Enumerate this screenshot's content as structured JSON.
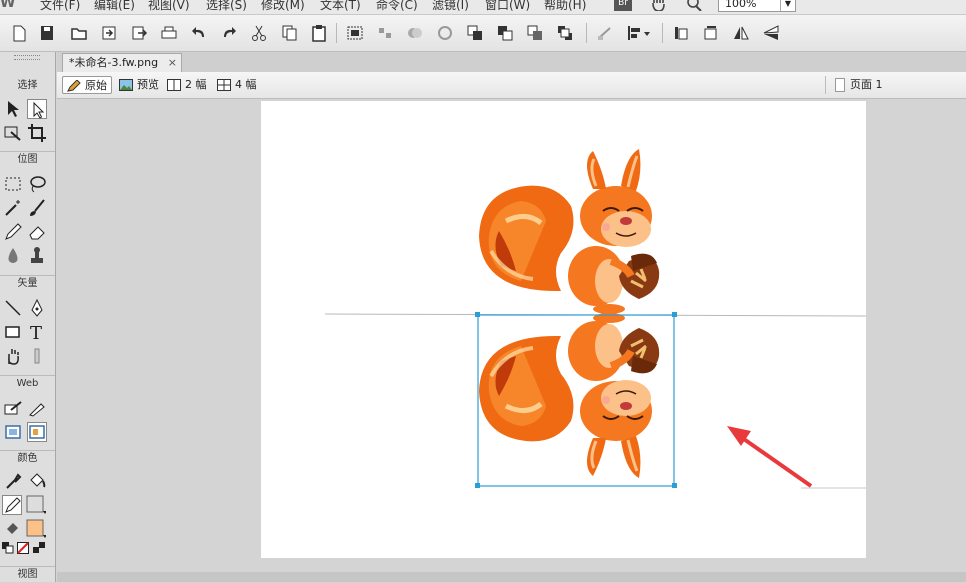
{
  "menu": {
    "logo": "W",
    "items": [
      "文件(F)",
      "编辑(E)",
      "视图(V)",
      "选择(S)",
      "修改(M)",
      "文本(T)",
      "命令(C)",
      "滤镜(I)",
      "窗口(W)",
      "帮助(H)"
    ],
    "bridge_label": "Br",
    "zoom": "100%"
  },
  "tabs": {
    "document": "*未命名-3.fw.png",
    "close": "×"
  },
  "viewbar": {
    "original": "原始",
    "preview": "预览",
    "two_up": "2 幅",
    "four_up": "4 幅",
    "page": "页面 1"
  },
  "tools": {
    "select": "选择",
    "bitmap": "位图",
    "vector": "矢量",
    "web": "Web",
    "colors": "颜色",
    "view": "视图"
  },
  "colors": {
    "fill": "#fcc089",
    "selection": "#2a9fd6",
    "arrow": "#e8393c"
  }
}
